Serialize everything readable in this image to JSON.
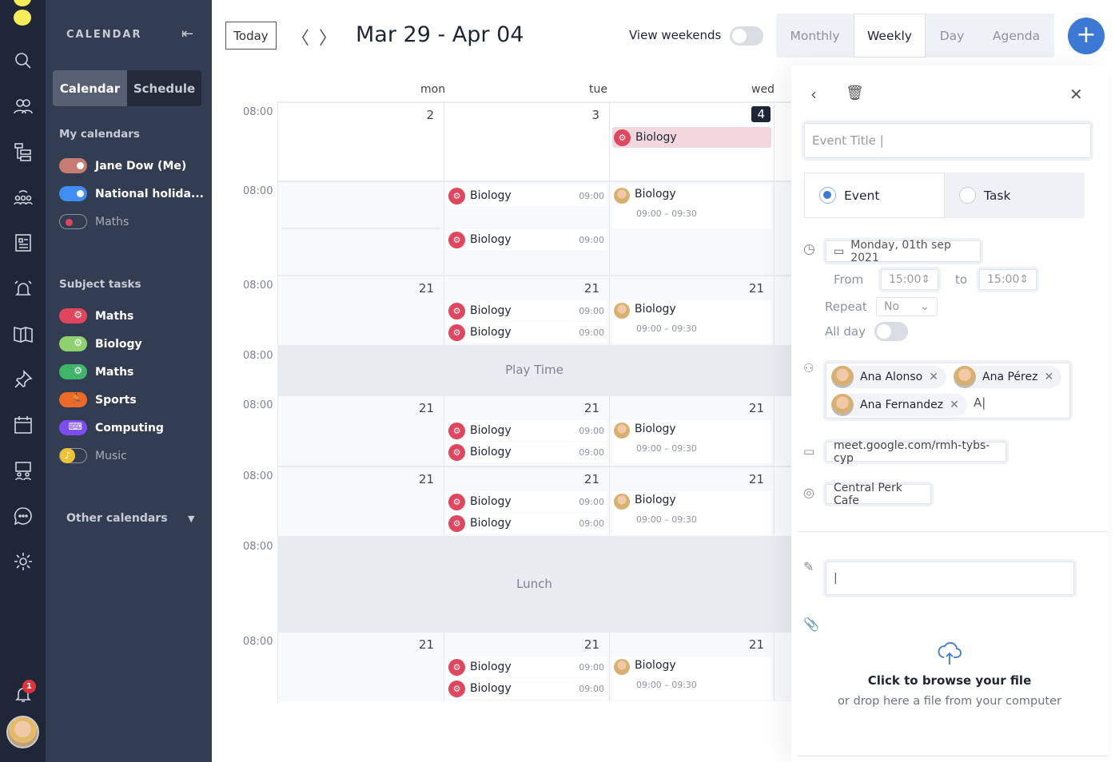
{
  "rail": {
    "icons": [
      "search-icon",
      "users-icon",
      "hierarchy-icon",
      "group-icon",
      "news-icon",
      "alarm-icon",
      "book-icon",
      "pin-icon",
      "calendar-icon",
      "presentation-icon",
      "chat-icon",
      "gear-icon"
    ],
    "notifications": "1"
  },
  "sidebar": {
    "title": "CALENDAR",
    "tabs": [
      "Calendar",
      "Schedule"
    ],
    "my_calendars_label": "My calendars",
    "my_calendars": [
      {
        "name": "Jane Dow (Me)",
        "color": "#c77b72",
        "on": true
      },
      {
        "name": "National holida...",
        "color": "#3f8ef5",
        "on": true
      },
      {
        "name": "Maths",
        "color": "#e0465e",
        "on": false
      }
    ],
    "subject_tasks_label": "Subject tasks",
    "subject_tasks": [
      {
        "name": "Maths",
        "color": "#e0465e",
        "icon": "gear-icon",
        "on": true
      },
      {
        "name": "Biology",
        "color": "#8fd16f",
        "icon": "gear-icon",
        "on": true
      },
      {
        "name": "Maths",
        "color": "#3fb46a",
        "icon": "gear-icon",
        "on": true
      },
      {
        "name": "Sports",
        "color": "#ec6a28",
        "icon": "runner-icon",
        "on": true
      },
      {
        "name": "Computing",
        "color": "#7c4df0",
        "icon": "keyboard-icon",
        "on": true
      },
      {
        "name": "Music",
        "color": "#f1c232",
        "icon": "music-icon",
        "on": false
      }
    ],
    "other_calendars": "Other calendars"
  },
  "toolbar": {
    "today": "Today",
    "range": "Mar 29 - Apr 04",
    "view_weekends": "View weekends",
    "view_weekends_on": false,
    "views": [
      "Monthly",
      "Weekly",
      "Day",
      "Agenda"
    ],
    "active_view": "Weekly"
  },
  "days": [
    "mon",
    "tue",
    "wed"
  ],
  "rows": [
    {
      "time": "08:00",
      "cells": [
        {
          "date": "2",
          "events": []
        },
        {
          "date": "3",
          "events": []
        },
        {
          "date": "4",
          "today": true,
          "events": [
            {
              "title": "Biology",
              "kind": "banner"
            }
          ]
        }
      ]
    },
    {
      "time": "08:00",
      "cells": [
        {
          "events": []
        },
        {
          "events": [
            {
              "title": "Biology",
              "time": "09:00"
            },
            {
              "title": "Biology",
              "time": "09:00"
            }
          ]
        },
        {
          "events": [
            {
              "title": "Biology",
              "range": "09:00 – 09:30",
              "kind": "person"
            }
          ]
        }
      ]
    },
    {
      "time": "08:00",
      "cells": [
        {
          "date": "21",
          "events": []
        },
        {
          "date": "21",
          "events": [
            {
              "title": "Biology",
              "time": "09:00"
            },
            {
              "title": "Biology",
              "time": "09:00"
            }
          ]
        },
        {
          "date": "21",
          "events": [
            {
              "title": "Biology",
              "range": "09:00 – 09:30",
              "kind": "person"
            }
          ]
        }
      ]
    },
    {
      "time": "08:00",
      "label": "Play Time"
    },
    {
      "time": "08:00",
      "cells": [
        {
          "date": "21",
          "events": []
        },
        {
          "date": "21",
          "events": [
            {
              "title": "Biology",
              "time": "09:00"
            },
            {
              "title": "Biology",
              "time": "09:00"
            }
          ]
        },
        {
          "date": "21",
          "events": [
            {
              "title": "Biology",
              "range": "09:00 – 09:30",
              "kind": "person"
            }
          ]
        }
      ]
    },
    {
      "time": "08:00",
      "cells": [
        {
          "date": "21",
          "events": []
        },
        {
          "date": "21",
          "events": [
            {
              "title": "Biology",
              "time": "09:00"
            },
            {
              "title": "Biology",
              "time": "09:00"
            }
          ]
        },
        {
          "date": "21",
          "events": [
            {
              "title": "Biology",
              "range": "09:00 – 09:30",
              "kind": "person"
            }
          ]
        }
      ]
    },
    {
      "time": "08:00",
      "label": "Lunch"
    },
    {
      "time": "08:00",
      "cells": [
        {
          "date": "21",
          "events": []
        },
        {
          "date": "21",
          "events": [
            {
              "title": "Biology",
              "time": "09:00"
            },
            {
              "title": "Biology",
              "time": "09:00"
            }
          ]
        },
        {
          "date": "21",
          "events": [
            {
              "title": "Biology",
              "range": "09:00 – 09:30",
              "kind": "person"
            }
          ]
        }
      ]
    }
  ],
  "panel": {
    "title_placeholder": "Event Title",
    "types": [
      "Event",
      "Task"
    ],
    "selected_type": "Event",
    "date": "Monday, 01th sep 2021",
    "from_label": "From",
    "from": "15:00",
    "to_label": "to",
    "to": "15:00",
    "repeat_label": "Repeat",
    "repeat": "No",
    "allday_label": "All day",
    "allday": false,
    "guests": [
      "Ana Alonso",
      "Ana Pérez",
      "Ana Fernandez"
    ],
    "guest_input": "A",
    "meet_link": "meet.google.com/rmh-tybs-cyp",
    "location": "Central Perk Cafe",
    "upload_title": "Click to browse your file",
    "upload_sub": "or drop here a file from your computer",
    "accent": "#3c79d4"
  }
}
